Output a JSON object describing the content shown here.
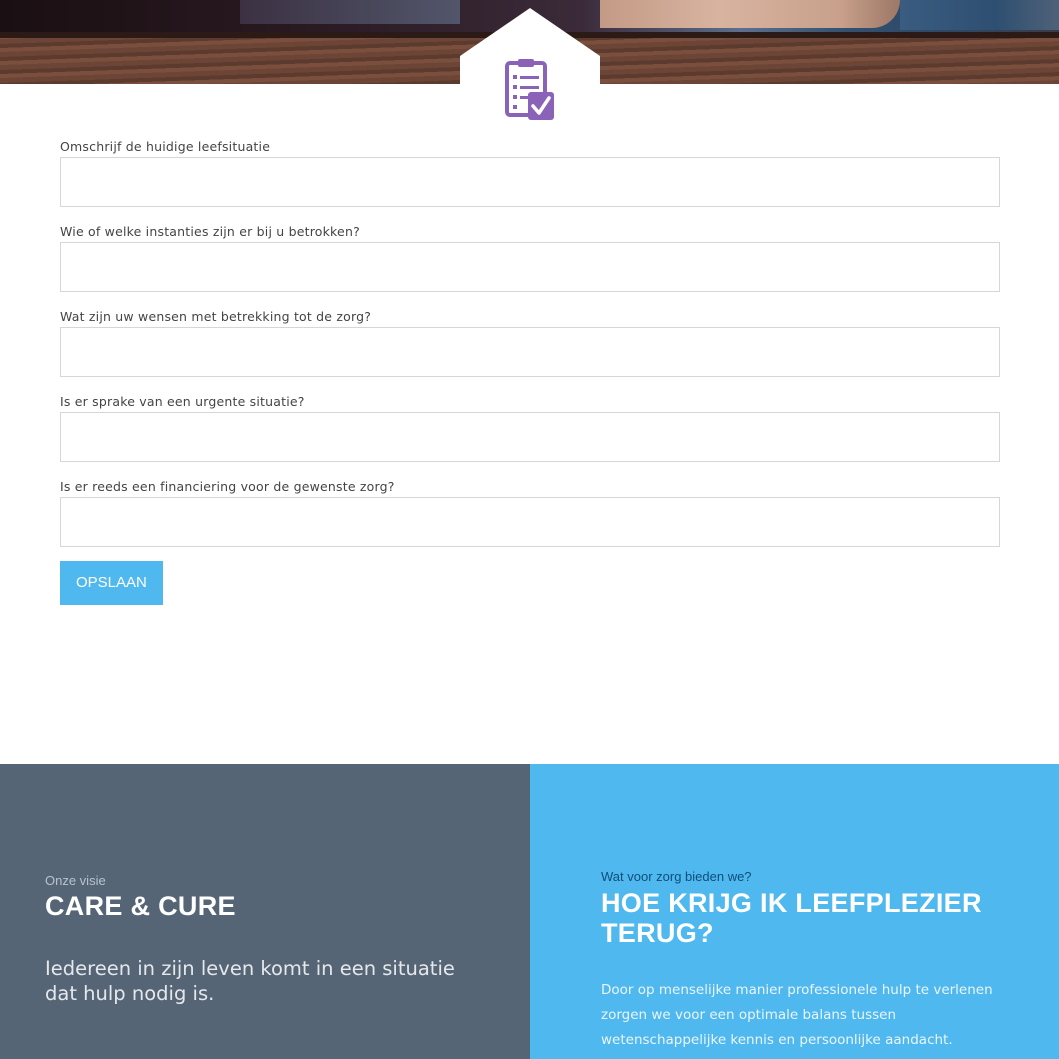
{
  "form": {
    "fields": [
      {
        "label": "Omschrijf de huidige leefsituatie",
        "value": "",
        "placeholder": ""
      },
      {
        "label": "Wie of welke instanties zijn er bij u betrokken?",
        "value": "",
        "placeholder": ""
      },
      {
        "label": "Wat zijn uw wensen met betrekking tot de zorg?",
        "value": "",
        "placeholder": ""
      },
      {
        "label": "Is er sprake van een urgente situatie?",
        "value": "",
        "placeholder": ""
      },
      {
        "label": "Is er reeds een financiering voor de gewenste zorg?",
        "value": "",
        "placeholder": ""
      }
    ],
    "save_label": "OPSLAAN"
  },
  "hero": {
    "icon": "clipboard-check-icon"
  },
  "visie": {
    "kicker": "Onze visie",
    "title": "CARE & CURE",
    "lead": "Iedereen in zijn leven komt in een situatie dat hulp nodig is."
  },
  "zorg": {
    "kicker": "Wat voor zorg bieden we?",
    "title": "HOE KRIJG IK LEEFPLEZIER TERUG?",
    "body": "Door op menselijke manier professionele hulp te verlenen zorgen we voor een optimale balans tussen wetenschappelijke kennis en persoonlijke aandacht."
  },
  "colors": {
    "accent": "#4fb8ef",
    "icon": "#8a63b8",
    "panel_dark": "#566575"
  }
}
